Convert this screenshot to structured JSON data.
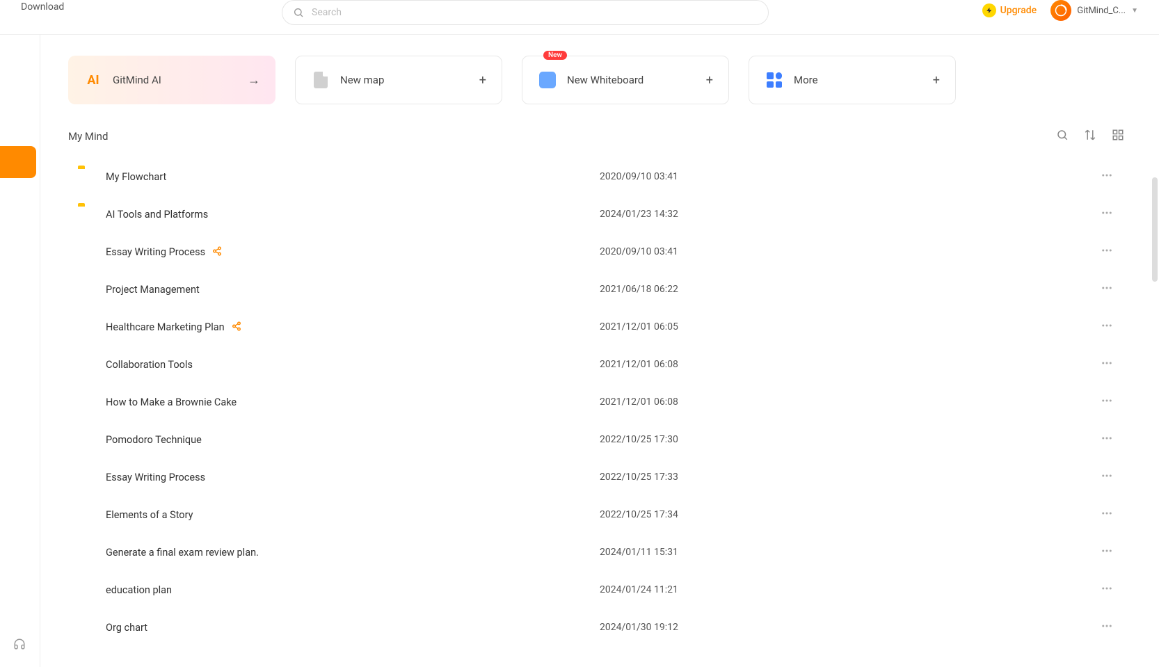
{
  "header": {
    "download_label": "Download",
    "search_placeholder": "Search",
    "upgrade_label": "Upgrade",
    "username": "GitMind_C..."
  },
  "quick_actions": [
    {
      "id": "gitmind-ai",
      "label": "GitMind AI",
      "icon": "ai",
      "end_icon": "arrow"
    },
    {
      "id": "new-map",
      "label": "New map",
      "icon": "doc",
      "end_icon": "plus"
    },
    {
      "id": "new-whiteboard",
      "label": "New Whiteboard",
      "icon": "whiteboard",
      "end_icon": "plus",
      "badge": "New"
    },
    {
      "id": "more",
      "label": "More",
      "icon": "more",
      "end_icon": "plus"
    }
  ],
  "section": {
    "title": "My Mind"
  },
  "files": [
    {
      "type": "folder",
      "name": "My Flowchart",
      "date": "2020/09/10 03:41",
      "shared": false
    },
    {
      "type": "folder",
      "name": "AI Tools and Platforms",
      "date": "2024/01/23 14:32",
      "shared": false
    },
    {
      "type": "mindmap",
      "name": "Essay Writing Process",
      "date": "2020/09/10 03:41",
      "shared": true
    },
    {
      "type": "mindmap",
      "name": "Project Management",
      "date": "2021/06/18 06:22",
      "shared": false
    },
    {
      "type": "mindmap",
      "name": "Healthcare Marketing Plan",
      "date": "2021/12/01 06:05",
      "shared": true
    },
    {
      "type": "mindmap",
      "name": "Collaboration Tools",
      "date": "2021/12/01 06:08",
      "shared": false
    },
    {
      "type": "mindmap",
      "name": "How to Make a Brownie Cake",
      "date": "2021/12/01 06:08",
      "shared": false
    },
    {
      "type": "mindmap",
      "name": "Pomodoro Technique",
      "date": "2022/10/25 17:30",
      "shared": false
    },
    {
      "type": "mindmap",
      "name": "Essay Writing Process",
      "date": "2022/10/25 17:33",
      "shared": false
    },
    {
      "type": "mindmap",
      "name": "Elements of a Story",
      "date": "2022/10/25 17:34",
      "shared": false
    },
    {
      "type": "mindmap",
      "name": "Generate a final exam review plan.",
      "date": "2024/01/11 15:31",
      "shared": false
    },
    {
      "type": "mindmap",
      "name": "education plan",
      "date": "2024/01/24 11:21",
      "shared": false
    },
    {
      "type": "mindmap",
      "name": "Org chart",
      "date": "2024/01/30 19:12",
      "shared": false
    }
  ]
}
